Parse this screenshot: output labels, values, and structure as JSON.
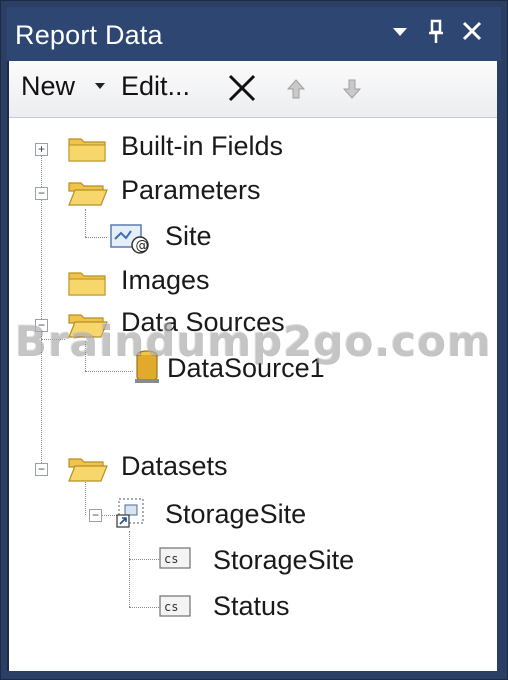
{
  "window": {
    "title": "Report Data",
    "controls": [
      "dropdown-icon",
      "pin-icon",
      "close-icon"
    ]
  },
  "toolbar": {
    "new_label": "New",
    "edit_label": "Edit...",
    "delete_icon": "delete-x-icon",
    "move_up_icon": "arrow-up-icon",
    "move_down_icon": "arrow-down-icon"
  },
  "tree": {
    "builtin_fields": "Built-in Fields",
    "parameters": "Parameters",
    "param_site": "Site",
    "images": "Images",
    "data_sources": "Data Sources",
    "datasource1": "DataSource1",
    "datasets": "Datasets",
    "dataset_storagesite": "StorageSite",
    "field_storagesite": "StorageSite",
    "field_status": "Status"
  },
  "watermark": "Braindump2go.com",
  "colors": {
    "title_bar": "#2e4672",
    "frame": "#2b3e63",
    "folder": "#f0c44c"
  }
}
